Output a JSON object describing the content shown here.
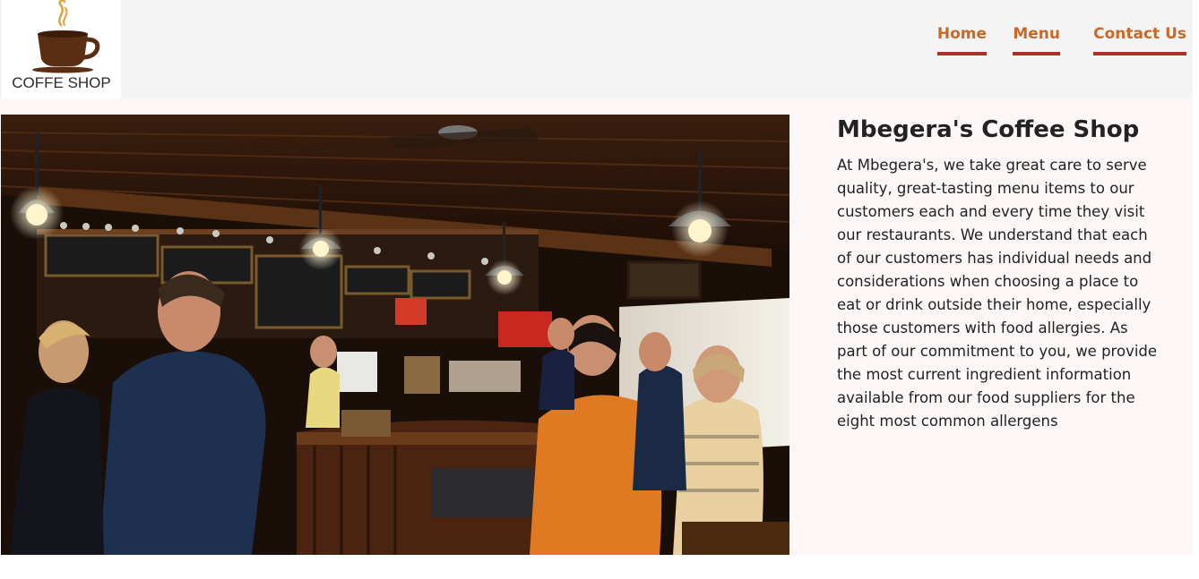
{
  "logo": {
    "text": "COFFE SHOP",
    "icon": "coffee-cup-icon",
    "colors": {
      "cup": "#5a2e12",
      "steam": "#e0a040"
    }
  },
  "nav": {
    "items": [
      {
        "label": "Home"
      },
      {
        "label": "Menu"
      },
      {
        "label": "Contact Us"
      }
    ],
    "link_color": "#c8692a",
    "underline_color": "#a83228"
  },
  "hero": {
    "image": "coffee-shop-interior-photo"
  },
  "about": {
    "title": "Mbegera's Coffee Shop",
    "description": "At Mbegera's, we take great care to serve quality, great-tasting menu items to our customers each and every time they visit our restaurants. We understand that each of our customers has individual needs and considerations when choosing a place to eat or drink outside their home, especially those customers with food allergies. As part of our commitment to you, we provide the most current ingredient information available from our food suppliers for the eight most common allergens"
  }
}
